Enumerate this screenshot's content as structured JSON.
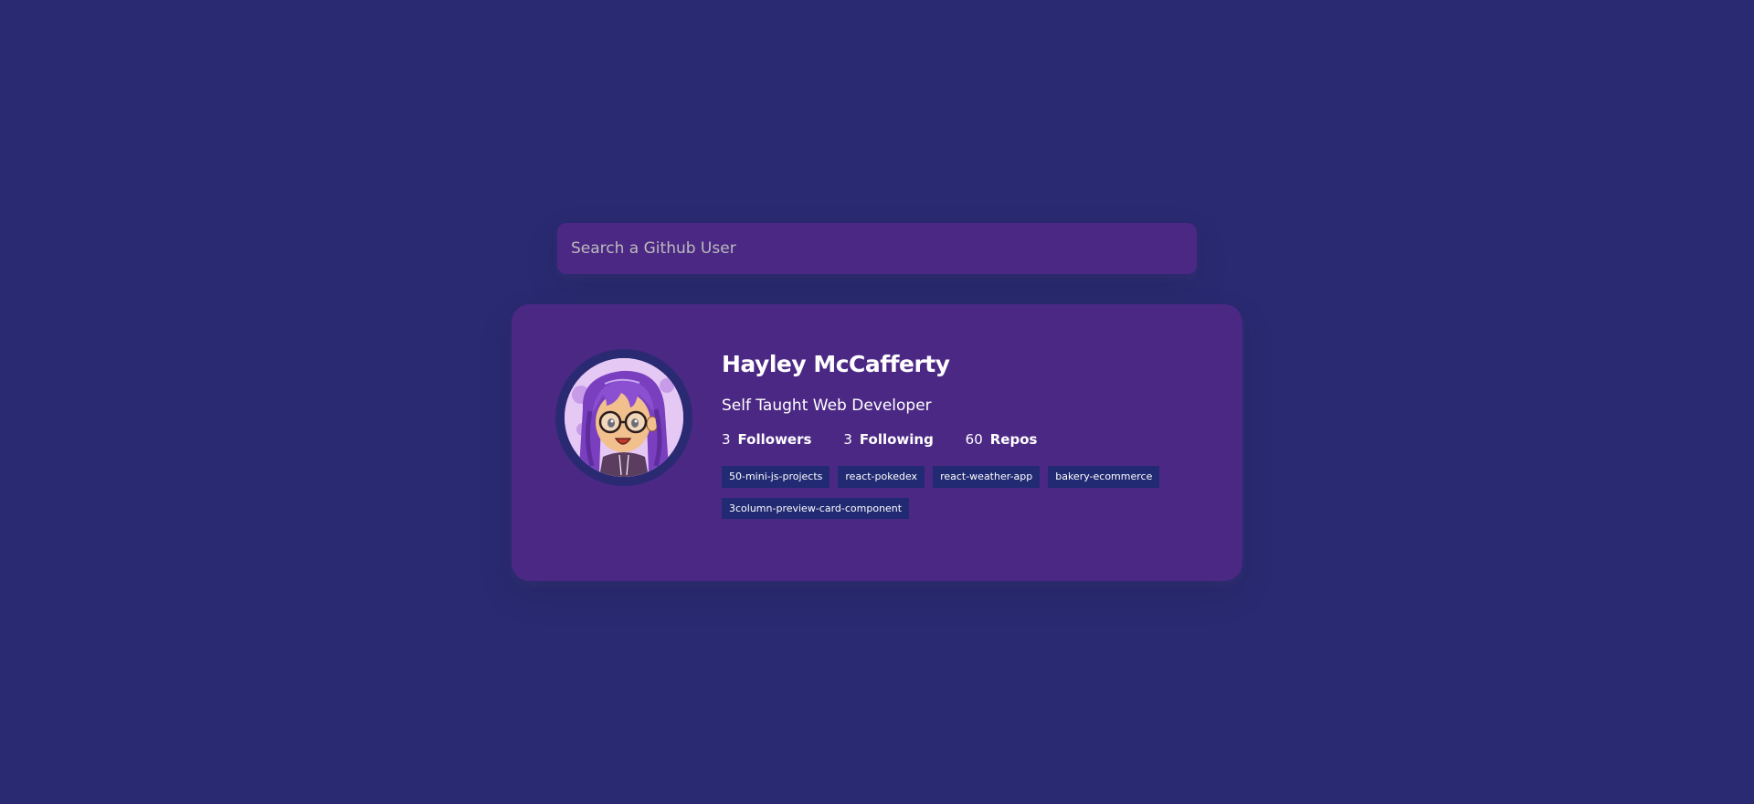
{
  "search": {
    "placeholder": "Search a Github User",
    "value": ""
  },
  "profile": {
    "name": "Hayley McCafferty",
    "bio": "Self Taught Web Developer",
    "stats": [
      {
        "count": "3",
        "label": "Followers"
      },
      {
        "count": "3",
        "label": "Following"
      },
      {
        "count": "60",
        "label": "Repos"
      }
    ],
    "repos": [
      "50-mini-js-projects",
      "react-pokedex",
      "react-weather-app",
      "bakery-ecommerce",
      "3column-preview-card-component"
    ]
  },
  "colors": {
    "background": "#2a2a72",
    "card": "#4c2885",
    "repo_badge": "#212a72",
    "text": "#ffffff"
  },
  "icons": {
    "avatar": "cartoon-avatar-purple-hair-glasses"
  }
}
